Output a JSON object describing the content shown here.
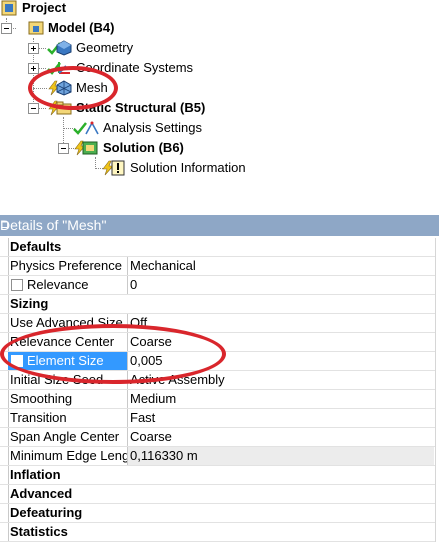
{
  "tree": {
    "root": {
      "label": "Project",
      "icon": "project-icon"
    },
    "model": {
      "label": "Model (B4)",
      "icon": "model-icon"
    },
    "geometry": {
      "label": "Geometry",
      "icon": "geometry-icon"
    },
    "coordinate_systems": {
      "label": "Coordinate Systems",
      "icon": "coordinate-systems-icon"
    },
    "mesh": {
      "label": "Mesh",
      "icon": "mesh-icon"
    },
    "static_structural": {
      "label": "Static Structural (B5)",
      "icon": "static-structural-icon"
    },
    "analysis_settings": {
      "label": "Analysis Settings",
      "icon": "analysis-settings-icon"
    },
    "solution": {
      "label": "Solution (B6)",
      "icon": "solution-icon"
    },
    "solution_information": {
      "label": "Solution Information",
      "icon": "solution-information-icon"
    }
  },
  "details": {
    "title": "Details of \"Mesh\"",
    "pin": "⊐",
    "sections": {
      "defaults": "Defaults",
      "sizing": "Sizing",
      "inflation": "Inflation",
      "advanced": "Advanced",
      "defeaturing": "Defeaturing",
      "statistics": "Statistics"
    },
    "rows": {
      "physics_preference": {
        "name": "Physics Preference",
        "value": "Mechanical"
      },
      "relevance": {
        "name": "Relevance",
        "value": "0"
      },
      "use_advanced_size": {
        "name": "Use Advanced Size Function",
        "value": "Off"
      },
      "relevance_center": {
        "name": "Relevance Center",
        "value": "Coarse"
      },
      "element_size": {
        "name": "Element Size",
        "value": "0,005"
      },
      "initial_size_seed": {
        "name": "Initial Size Seed",
        "value": "Active Assembly"
      },
      "smoothing": {
        "name": "Smoothing",
        "value": "Medium"
      },
      "transition": {
        "name": "Transition",
        "value": "Fast"
      },
      "span_angle_center": {
        "name": "Span Angle Center",
        "value": "Coarse"
      },
      "minimum_edge_length": {
        "name": "Minimum Edge Length",
        "value": "0,116330 m"
      }
    }
  },
  "colors": {
    "annotation": "#d9262c",
    "selection": "#3399ff",
    "title_bar": "#8ea7c6",
    "check_green": "#2bb02b",
    "lightning_yellow": "#f0c419"
  }
}
